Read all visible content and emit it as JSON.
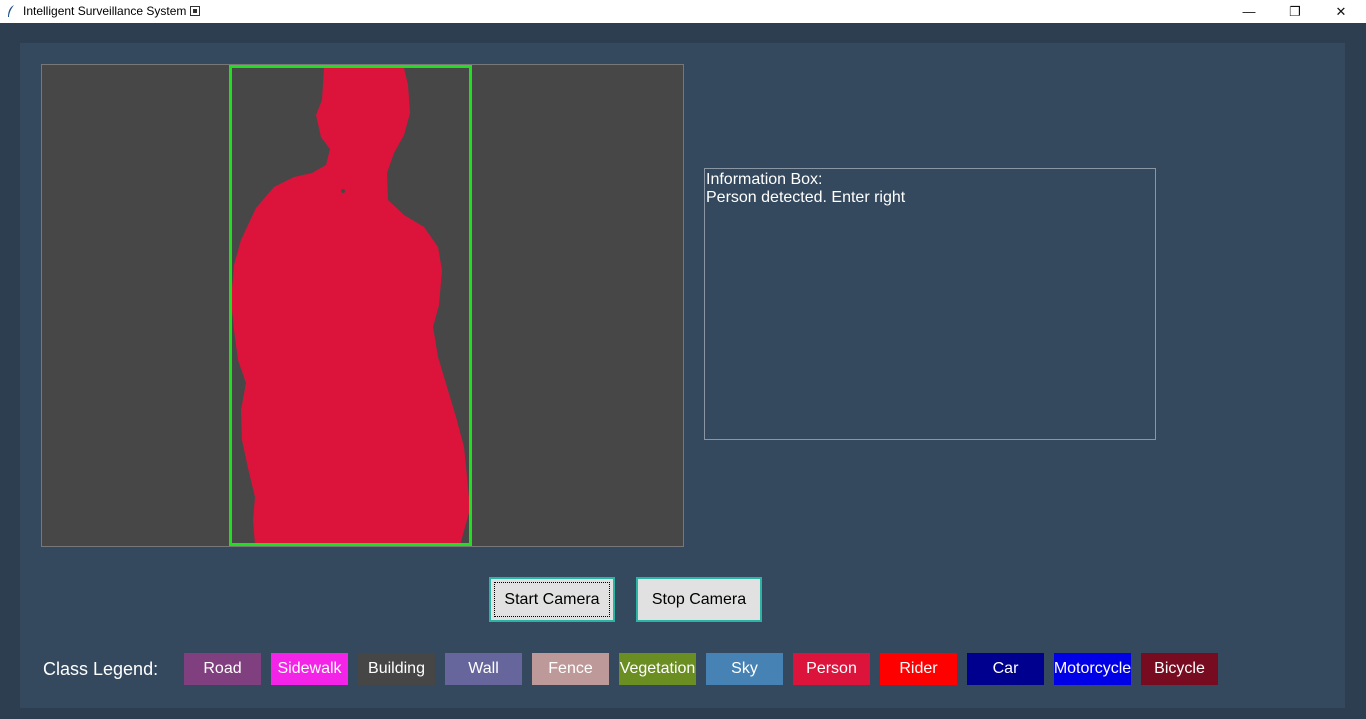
{
  "window": {
    "title": "Intelligent Surveillance System",
    "minimize_glyph": "—",
    "restore_glyph": "❐",
    "close_glyph": "✕"
  },
  "info_box": {
    "heading": "Information Box:",
    "message": "Person detected. Enter right"
  },
  "buttons": {
    "start_label": "Start Camera",
    "stop_label": "Stop Camera"
  },
  "legend": {
    "label": "Class Legend:",
    "items": [
      {
        "label": "Road",
        "color": "#80407f"
      },
      {
        "label": "Sidewalk",
        "color": "#f423e8"
      },
      {
        "label": "Building",
        "color": "#464646"
      },
      {
        "label": "Wall",
        "color": "#66669c"
      },
      {
        "label": "Fence",
        "color": "#be9999"
      },
      {
        "label": "Vegetation",
        "color": "#6b8e23"
      },
      {
        "label": "Sky",
        "color": "#4682b4"
      },
      {
        "label": "Person",
        "color": "#dc143c"
      },
      {
        "label": "Rider",
        "color": "#ff0000"
      },
      {
        "label": "Car",
        "color": "#00008e"
      },
      {
        "label": "Motorcycle",
        "color": "#0000e6"
      },
      {
        "label": "Bicycle",
        "color": "#770b20"
      }
    ]
  },
  "colors": {
    "background": "#2c3e50",
    "panel": "#34495e",
    "video_background": "#474747",
    "person_mask": "#dc143c",
    "detection_box": "#22dd22"
  }
}
